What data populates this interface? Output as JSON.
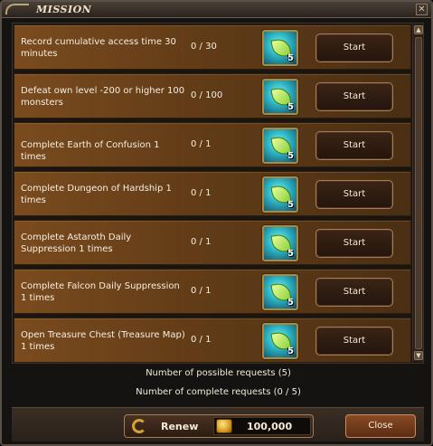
{
  "window": {
    "title": "MISSION",
    "close_glyph": "✕"
  },
  "missions": [
    {
      "description": "Record cumulative access time 30 minutes",
      "progress": "0 / 30",
      "reward_count": "5",
      "start_label": "Start"
    },
    {
      "description": "Defeat own level -200 or higher 100 monsters",
      "progress": "0 / 100",
      "reward_count": "5",
      "start_label": "Start"
    },
    {
      "description": "Complete Earth of Confusion 1 times",
      "progress": "0 / 1",
      "reward_count": "5",
      "start_label": "Start"
    },
    {
      "description": "Complete Dungeon of Hardship 1 times",
      "progress": "0 / 1",
      "reward_count": "5",
      "start_label": "Start"
    },
    {
      "description": "Complete Astaroth Daily Suppression 1 times",
      "progress": "0 / 1",
      "reward_count": "5",
      "start_label": "Start"
    },
    {
      "description": "Complete Falcon Daily Suppression 1 times",
      "progress": "0 / 1",
      "reward_count": "5",
      "start_label": "Start"
    },
    {
      "description": "Open Treasure Chest (Treasure Map) 1 times",
      "progress": "0 / 1",
      "reward_count": "5",
      "start_label": "Start"
    }
  ],
  "scrollbar": {
    "up_glyph": "▲",
    "down_glyph": "▼"
  },
  "info": {
    "possible_requests": "Number of possible requests (5)",
    "complete_requests": "Number of complete requests (0 / 5)"
  },
  "footer": {
    "renew_label": "Renew",
    "renew_cost": "100,000",
    "close_label": "Close"
  },
  "icons": {
    "reward": "leaf-gem-icon",
    "renew": "refresh-icon",
    "currency": "gold-coin-icon"
  }
}
